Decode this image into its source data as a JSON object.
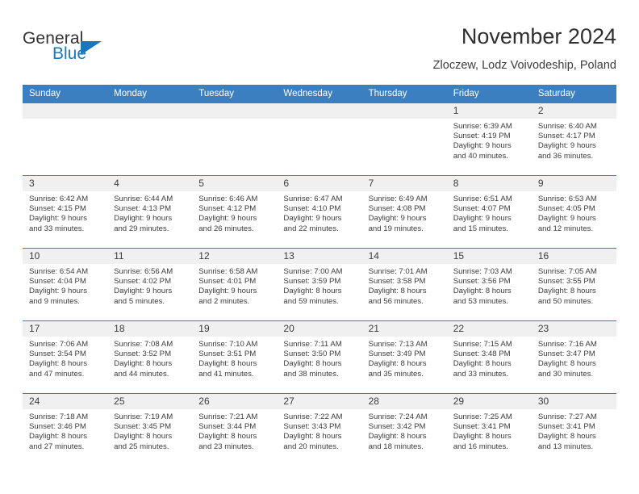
{
  "brand": {
    "line1": "General",
    "line2": "Blue",
    "accent": "#1b76bc"
  },
  "header": {
    "title": "November 2024",
    "subtitle": "Zloczew, Lodz Voivodeship, Poland"
  },
  "theme": {
    "header_bg": "#3c7fc1",
    "date_band_bg": "#f0f0f0",
    "text": "#3c3c3c"
  },
  "weekdays": [
    "Sunday",
    "Monday",
    "Tuesday",
    "Wednesday",
    "Thursday",
    "Friday",
    "Saturday"
  ],
  "weeks": [
    [
      {
        "day": "",
        "empty": true
      },
      {
        "day": "",
        "empty": true
      },
      {
        "day": "",
        "empty": true
      },
      {
        "day": "",
        "empty": true
      },
      {
        "day": "",
        "empty": true
      },
      {
        "day": "1",
        "sunrise": "Sunrise: 6:39 AM",
        "sunset": "Sunset: 4:19 PM",
        "daylight1": "Daylight: 9 hours",
        "daylight2": "and 40 minutes."
      },
      {
        "day": "2",
        "sunrise": "Sunrise: 6:40 AM",
        "sunset": "Sunset: 4:17 PM",
        "daylight1": "Daylight: 9 hours",
        "daylight2": "and 36 minutes."
      }
    ],
    [
      {
        "day": "3",
        "sunrise": "Sunrise: 6:42 AM",
        "sunset": "Sunset: 4:15 PM",
        "daylight1": "Daylight: 9 hours",
        "daylight2": "and 33 minutes."
      },
      {
        "day": "4",
        "sunrise": "Sunrise: 6:44 AM",
        "sunset": "Sunset: 4:13 PM",
        "daylight1": "Daylight: 9 hours",
        "daylight2": "and 29 minutes."
      },
      {
        "day": "5",
        "sunrise": "Sunrise: 6:46 AM",
        "sunset": "Sunset: 4:12 PM",
        "daylight1": "Daylight: 9 hours",
        "daylight2": "and 26 minutes."
      },
      {
        "day": "6",
        "sunrise": "Sunrise: 6:47 AM",
        "sunset": "Sunset: 4:10 PM",
        "daylight1": "Daylight: 9 hours",
        "daylight2": "and 22 minutes."
      },
      {
        "day": "7",
        "sunrise": "Sunrise: 6:49 AM",
        "sunset": "Sunset: 4:08 PM",
        "daylight1": "Daylight: 9 hours",
        "daylight2": "and 19 minutes."
      },
      {
        "day": "8",
        "sunrise": "Sunrise: 6:51 AM",
        "sunset": "Sunset: 4:07 PM",
        "daylight1": "Daylight: 9 hours",
        "daylight2": "and 15 minutes."
      },
      {
        "day": "9",
        "sunrise": "Sunrise: 6:53 AM",
        "sunset": "Sunset: 4:05 PM",
        "daylight1": "Daylight: 9 hours",
        "daylight2": "and 12 minutes."
      }
    ],
    [
      {
        "day": "10",
        "sunrise": "Sunrise: 6:54 AM",
        "sunset": "Sunset: 4:04 PM",
        "daylight1": "Daylight: 9 hours",
        "daylight2": "and 9 minutes."
      },
      {
        "day": "11",
        "sunrise": "Sunrise: 6:56 AM",
        "sunset": "Sunset: 4:02 PM",
        "daylight1": "Daylight: 9 hours",
        "daylight2": "and 5 minutes."
      },
      {
        "day": "12",
        "sunrise": "Sunrise: 6:58 AM",
        "sunset": "Sunset: 4:01 PM",
        "daylight1": "Daylight: 9 hours",
        "daylight2": "and 2 minutes."
      },
      {
        "day": "13",
        "sunrise": "Sunrise: 7:00 AM",
        "sunset": "Sunset: 3:59 PM",
        "daylight1": "Daylight: 8 hours",
        "daylight2": "and 59 minutes."
      },
      {
        "day": "14",
        "sunrise": "Sunrise: 7:01 AM",
        "sunset": "Sunset: 3:58 PM",
        "daylight1": "Daylight: 8 hours",
        "daylight2": "and 56 minutes."
      },
      {
        "day": "15",
        "sunrise": "Sunrise: 7:03 AM",
        "sunset": "Sunset: 3:56 PM",
        "daylight1": "Daylight: 8 hours",
        "daylight2": "and 53 minutes."
      },
      {
        "day": "16",
        "sunrise": "Sunrise: 7:05 AM",
        "sunset": "Sunset: 3:55 PM",
        "daylight1": "Daylight: 8 hours",
        "daylight2": "and 50 minutes."
      }
    ],
    [
      {
        "day": "17",
        "sunrise": "Sunrise: 7:06 AM",
        "sunset": "Sunset: 3:54 PM",
        "daylight1": "Daylight: 8 hours",
        "daylight2": "and 47 minutes."
      },
      {
        "day": "18",
        "sunrise": "Sunrise: 7:08 AM",
        "sunset": "Sunset: 3:52 PM",
        "daylight1": "Daylight: 8 hours",
        "daylight2": "and 44 minutes."
      },
      {
        "day": "19",
        "sunrise": "Sunrise: 7:10 AM",
        "sunset": "Sunset: 3:51 PM",
        "daylight1": "Daylight: 8 hours",
        "daylight2": "and 41 minutes."
      },
      {
        "day": "20",
        "sunrise": "Sunrise: 7:11 AM",
        "sunset": "Sunset: 3:50 PM",
        "daylight1": "Daylight: 8 hours",
        "daylight2": "and 38 minutes."
      },
      {
        "day": "21",
        "sunrise": "Sunrise: 7:13 AM",
        "sunset": "Sunset: 3:49 PM",
        "daylight1": "Daylight: 8 hours",
        "daylight2": "and 35 minutes."
      },
      {
        "day": "22",
        "sunrise": "Sunrise: 7:15 AM",
        "sunset": "Sunset: 3:48 PM",
        "daylight1": "Daylight: 8 hours",
        "daylight2": "and 33 minutes."
      },
      {
        "day": "23",
        "sunrise": "Sunrise: 7:16 AM",
        "sunset": "Sunset: 3:47 PM",
        "daylight1": "Daylight: 8 hours",
        "daylight2": "and 30 minutes."
      }
    ],
    [
      {
        "day": "24",
        "sunrise": "Sunrise: 7:18 AM",
        "sunset": "Sunset: 3:46 PM",
        "daylight1": "Daylight: 8 hours",
        "daylight2": "and 27 minutes."
      },
      {
        "day": "25",
        "sunrise": "Sunrise: 7:19 AM",
        "sunset": "Sunset: 3:45 PM",
        "daylight1": "Daylight: 8 hours",
        "daylight2": "and 25 minutes."
      },
      {
        "day": "26",
        "sunrise": "Sunrise: 7:21 AM",
        "sunset": "Sunset: 3:44 PM",
        "daylight1": "Daylight: 8 hours",
        "daylight2": "and 23 minutes."
      },
      {
        "day": "27",
        "sunrise": "Sunrise: 7:22 AM",
        "sunset": "Sunset: 3:43 PM",
        "daylight1": "Daylight: 8 hours",
        "daylight2": "and 20 minutes."
      },
      {
        "day": "28",
        "sunrise": "Sunrise: 7:24 AM",
        "sunset": "Sunset: 3:42 PM",
        "daylight1": "Daylight: 8 hours",
        "daylight2": "and 18 minutes."
      },
      {
        "day": "29",
        "sunrise": "Sunrise: 7:25 AM",
        "sunset": "Sunset: 3:41 PM",
        "daylight1": "Daylight: 8 hours",
        "daylight2": "and 16 minutes."
      },
      {
        "day": "30",
        "sunrise": "Sunrise: 7:27 AM",
        "sunset": "Sunset: 3:41 PM",
        "daylight1": "Daylight: 8 hours",
        "daylight2": "and 13 minutes."
      }
    ]
  ]
}
